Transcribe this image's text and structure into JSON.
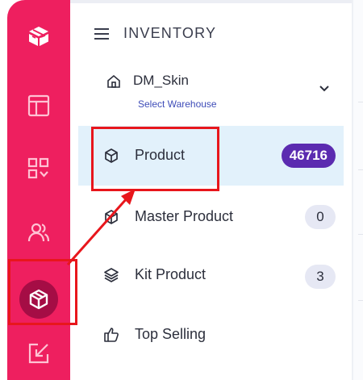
{
  "header": {
    "title": "INVENTORY"
  },
  "warehouse": {
    "name": "DM_Skin",
    "subtitle": "Select Warehouse"
  },
  "menu": [
    {
      "label": "Product",
      "badge": "46716"
    },
    {
      "label": "Master Product",
      "badge": "0"
    },
    {
      "label": "Kit Product",
      "badge": "3"
    },
    {
      "label": "Top Selling",
      "badge": ""
    }
  ],
  "icons": {
    "logo": "brand-logo-icon",
    "dashboard": "dashboard-icon",
    "apps": "apps-icon",
    "users": "users-icon",
    "inventory": "box-icon",
    "export": "export-icon",
    "menu": "hamburger-icon",
    "home": "home-icon",
    "chevron": "chevron-down-icon",
    "product": "box-icon",
    "kit": "layers-icon",
    "top_selling": "thumbs-up-icon"
  },
  "colors": {
    "rail": "#ee1f5f",
    "rail_active": "#a50d45",
    "active_item_bg": "#e2f1fb",
    "badge_primary": "#5b2bb0",
    "badge_muted": "#e6e8f4",
    "annotation": "#e8161c",
    "subtitle": "#3e4cb8"
  }
}
